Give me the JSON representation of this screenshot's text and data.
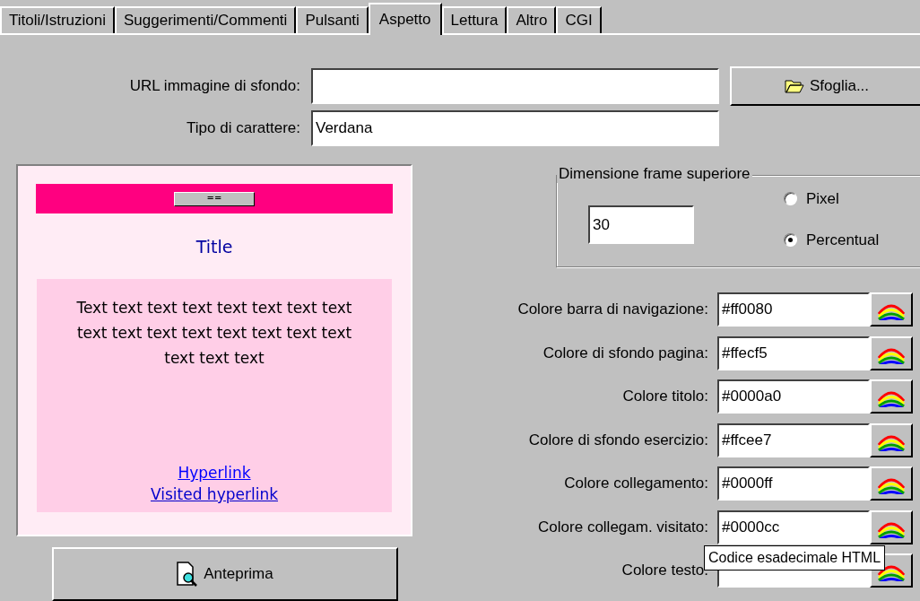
{
  "tabs": [
    {
      "label": "Titoli/Istruzioni",
      "selected": false
    },
    {
      "label": "Suggerimenti/Commenti",
      "selected": false
    },
    {
      "label": "Pulsanti",
      "selected": false
    },
    {
      "label": "Aspetto",
      "selected": true
    },
    {
      "label": "Lettura",
      "selected": false
    },
    {
      "label": "Altro",
      "selected": false
    },
    {
      "label": "CGI",
      "selected": false
    }
  ],
  "background_url": {
    "label": "URL immagine di sfondo:"
  },
  "browse_button": "Sfoglia...",
  "font": {
    "label": "Tipo di carattere:",
    "value": "Verdana"
  },
  "preview": {
    "nav_button": "==",
    "title": "Title",
    "text": "Text text text text text text text text text text text text text text text text text text text",
    "link": "Hyperlink",
    "visited_link": "Visited hyperlink"
  },
  "preview_button": "Anteprima",
  "frame": {
    "title": "Dimensione frame superiore",
    "value": "30",
    "options": [
      {
        "label": "Pixel",
        "selected": false
      },
      {
        "label": "Percentual",
        "selected": true
      }
    ]
  },
  "colors": [
    {
      "label": "Colore barra di navigazione:",
      "value": "#ff0080"
    },
    {
      "label": "Colore di sfondo pagina:",
      "value": "#ffecf5"
    },
    {
      "label": "Colore titolo:",
      "value": "#0000a0"
    },
    {
      "label": "Colore di sfondo esercizio:",
      "value": "#ffcee7"
    },
    {
      "label": "Colore collegamento:",
      "value": "#0000ff"
    },
    {
      "label": "Colore collegam. visitato:",
      "value": "#0000cc"
    },
    {
      "label": "Colore testo:"
    }
  ],
  "tooltip": "Codice esadecimale HTML"
}
